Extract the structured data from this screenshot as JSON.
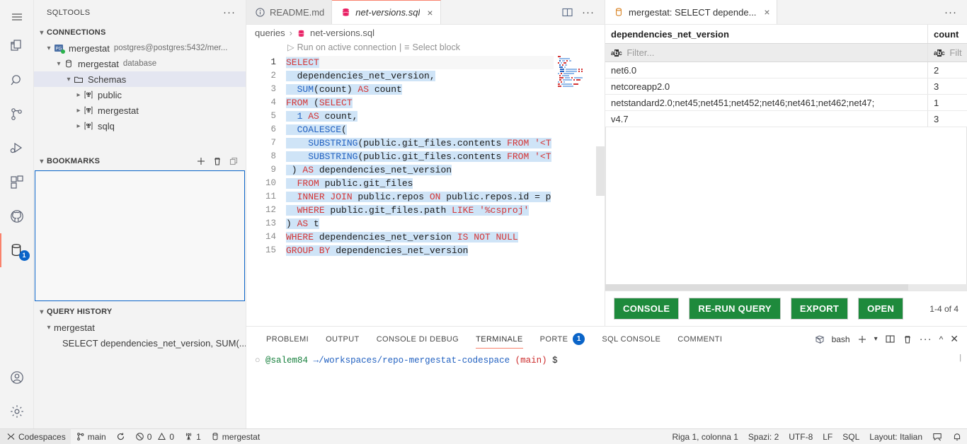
{
  "activitybar": {
    "items": [
      {
        "name": "menu-icon",
        "label": "Menu"
      },
      {
        "name": "explorer-icon",
        "label": "Explorer"
      },
      {
        "name": "search-icon",
        "label": "Search"
      },
      {
        "name": "source-control-icon",
        "label": "Source Control"
      },
      {
        "name": "run-debug-icon",
        "label": "Run and Debug"
      },
      {
        "name": "extensions-icon",
        "label": "Extensions"
      },
      {
        "name": "github-icon",
        "label": "GitHub"
      },
      {
        "name": "database-icon",
        "label": "SQLTools",
        "badge": "1"
      }
    ],
    "bottom": [
      {
        "name": "account-icon",
        "label": "Accounts"
      },
      {
        "name": "settings-gear-icon",
        "label": "Manage"
      }
    ]
  },
  "sidebar": {
    "title": "SQLTOOLS",
    "more_label": "···",
    "connections": {
      "header": "CONNECTIONS",
      "connection_name": "mergestat",
      "connection_detail": "postgres@postgres:5432/mer...",
      "database_name": "mergestat",
      "database_detail": "database",
      "schemas_label": "Schemas",
      "schemas": [
        "public",
        "mergestat",
        "sqlq"
      ]
    },
    "bookmarks": {
      "header": "BOOKMARKS",
      "add_label": "+",
      "delete_label": "🗑",
      "copy_label": "❐"
    },
    "query_history": {
      "header": "QUERY HISTORY",
      "group": "mergestat",
      "items": [
        "SELECT dependencies_net_version, SUM(..."
      ]
    }
  },
  "editor": {
    "tabs": [
      {
        "label": "README.md",
        "icon": "info-icon",
        "active": false
      },
      {
        "label": "net-versions.sql",
        "icon": "database-file-icon",
        "active": true,
        "close": "×"
      }
    ],
    "actions": {
      "split": "split-editor-icon",
      "more": "···"
    },
    "breadcrumb": {
      "folder": "queries",
      "separator": "›",
      "file": "net-versions.sql"
    },
    "codelens": {
      "run": "Run on active connection",
      "divider": "|",
      "select": "Select block"
    },
    "line_numbers": [
      "1",
      "2",
      "3",
      "4",
      "5",
      "6",
      "7",
      "8",
      "9",
      "10",
      "11",
      "12",
      "13",
      "14",
      "15"
    ],
    "code_lines": [
      [
        {
          "t": "SELECT",
          "c": "kw"
        }
      ],
      [
        {
          "t": "  ",
          "c": "id"
        },
        {
          "t": "dependencies_net_version,",
          "c": "id"
        }
      ],
      [
        {
          "t": "  ",
          "c": "id"
        },
        {
          "t": "SUM",
          "c": "fn"
        },
        {
          "t": "(count)",
          "c": "id"
        },
        {
          "t": " AS",
          "c": "kw"
        },
        {
          "t": " count",
          "c": "id"
        }
      ],
      [
        {
          "t": "FROM",
          "c": "kw"
        },
        {
          "t": " (",
          "c": "id"
        },
        {
          "t": "SELECT",
          "c": "kw"
        }
      ],
      [
        {
          "t": "  ",
          "c": "id"
        },
        {
          "t": "1",
          "c": "num"
        },
        {
          "t": " AS",
          "c": "kw"
        },
        {
          "t": " count,",
          "c": "id"
        }
      ],
      [
        {
          "t": "  ",
          "c": "id"
        },
        {
          "t": "COALESCE",
          "c": "fn"
        },
        {
          "t": "(",
          "c": "id"
        }
      ],
      [
        {
          "t": "    ",
          "c": "id"
        },
        {
          "t": "SUBSTRING",
          "c": "fn"
        },
        {
          "t": "(public.git_files.contents ",
          "c": "id"
        },
        {
          "t": "FROM",
          "c": "kw"
        },
        {
          "t": " '<T",
          "c": "str"
        }
      ],
      [
        {
          "t": "    ",
          "c": "id"
        },
        {
          "t": "SUBSTRING",
          "c": "fn"
        },
        {
          "t": "(public.git_files.contents ",
          "c": "id"
        },
        {
          "t": "FROM",
          "c": "kw"
        },
        {
          "t": " '<T",
          "c": "str"
        }
      ],
      [
        {
          "t": " )",
          "c": "id"
        },
        {
          "t": " AS",
          "c": "kw"
        },
        {
          "t": " dependencies_net_version",
          "c": "id"
        }
      ],
      [
        {
          "t": "  ",
          "c": "id"
        },
        {
          "t": "FROM",
          "c": "kw"
        },
        {
          "t": " public.git_files",
          "c": "id"
        }
      ],
      [
        {
          "t": "  ",
          "c": "id"
        },
        {
          "t": "INNER JOIN",
          "c": "kw"
        },
        {
          "t": " public.repos ",
          "c": "id"
        },
        {
          "t": "ON",
          "c": "kw"
        },
        {
          "t": " public.repos.id = p",
          "c": "id"
        }
      ],
      [
        {
          "t": "  ",
          "c": "id"
        },
        {
          "t": "WHERE",
          "c": "kw"
        },
        {
          "t": " public.git_files.path ",
          "c": "id"
        },
        {
          "t": "LIKE",
          "c": "kw"
        },
        {
          "t": " '%csproj'",
          "c": "str"
        }
      ],
      [
        {
          "t": ")",
          "c": "id"
        },
        {
          "t": " AS",
          "c": "kw"
        },
        {
          "t": " t",
          "c": "id"
        }
      ],
      [
        {
          "t": "WHERE",
          "c": "kw"
        },
        {
          "t": " dependencies_net_version ",
          "c": "id"
        },
        {
          "t": "IS NOT NULL",
          "c": "kw"
        }
      ],
      [
        {
          "t": "GROUP BY",
          "c": "kw"
        },
        {
          "t": " dependencies_net_version",
          "c": "id"
        }
      ]
    ]
  },
  "results": {
    "tab": {
      "label": "mergestat: SELECT depende...",
      "icon": "database-icon",
      "close": "×"
    },
    "more_label": "···",
    "columns": [
      "dependencies_net_version",
      "count"
    ],
    "filter_placeholder": "Filter...",
    "filter_placeholder_short": "Filt",
    "rows": [
      {
        "dependencies_net_version": "net6.0",
        "count": "2"
      },
      {
        "dependencies_net_version": "netcoreapp2.0",
        "count": "3"
      },
      {
        "dependencies_net_version": "netstandard2.0;net45;net451;net452;net46;net461;net462;net47;",
        "count": "1"
      },
      {
        "dependencies_net_version": "v4.7",
        "count": "3"
      }
    ],
    "buttons": [
      "CONSOLE",
      "RE-RUN QUERY",
      "EXPORT",
      "OPEN"
    ],
    "pagination": "1-4 of 4",
    "button_color": "#1e8a3c"
  },
  "panel": {
    "tabs": [
      {
        "label": "PROBLEMI",
        "active": false
      },
      {
        "label": "OUTPUT",
        "active": false
      },
      {
        "label": "CONSOLE DI DEBUG",
        "active": false
      },
      {
        "label": "TERMINALE",
        "active": true
      },
      {
        "label": "PORTE",
        "active": false,
        "badge": "1"
      },
      {
        "label": "SQL CONSOLE",
        "active": false
      },
      {
        "label": "COMMENTI",
        "active": false
      }
    ],
    "terminal_name": "bash",
    "actions": [
      "new-terminal-icon",
      "dropdown-icon",
      "split-terminal-icon",
      "kill-terminal-icon",
      "more-icon",
      "maximize-panel-icon",
      "close-panel-icon"
    ],
    "prompt": {
      "bullet": "○",
      "user": "@salem84",
      "arrow": "→",
      "path": "/workspaces/repo-mergestat-codespace",
      "branch": "(main)",
      "symbol": "$"
    }
  },
  "statusbar": {
    "left": [
      {
        "name": "remote-indicator",
        "label": "Codespaces",
        "icon": "remote-icon"
      },
      {
        "name": "branch-indicator",
        "label": "main",
        "icon": "git-branch-icon"
      },
      {
        "name": "sync-indicator",
        "label": "",
        "icon": "sync-icon"
      },
      {
        "name": "errors-warnings",
        "label": "0",
        "label2": "0",
        "icon": "error-icon",
        "icon2": "warning-icon"
      },
      {
        "name": "radio-tower",
        "label": "1",
        "icon": "radio-tower-icon"
      },
      {
        "name": "sqltools-connection",
        "label": "mergestat",
        "icon": "database-icon"
      }
    ],
    "right": [
      {
        "name": "cursor-position",
        "label": "Riga 1, colonna 1"
      },
      {
        "name": "indentation",
        "label": "Spazi: 2"
      },
      {
        "name": "encoding",
        "label": "UTF-8"
      },
      {
        "name": "eol",
        "label": "LF"
      },
      {
        "name": "language-mode",
        "label": "SQL"
      },
      {
        "name": "keyboard-layout",
        "label": "Layout: Italian"
      },
      {
        "name": "feedback-icon",
        "label": ""
      },
      {
        "name": "notifications-bell-icon",
        "label": ""
      }
    ]
  }
}
